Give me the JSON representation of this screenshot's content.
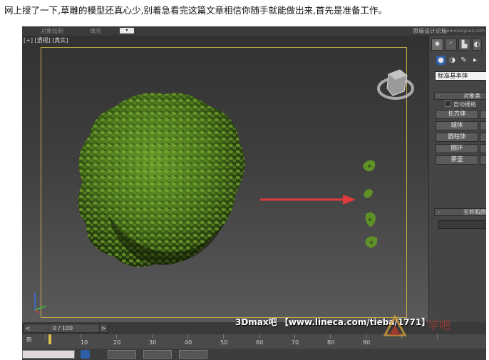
{
  "caption": "网上搜了一下,草雕的模型还真心少,别着急看完这篇文章相信你随手就能做出来,首先是准备工作。",
  "topbar": {
    "menu_left": "对象绘制",
    "menu_mid": "填充",
    "dropdown_value": "▾",
    "brand": "思缘设计论坛",
    "brand_url": "www.missyuan.com"
  },
  "viewport": {
    "label": "[+] [透视] [真实]",
    "frame_color": "#c9b045",
    "arrow_color": "#e23b3b",
    "foliage_color": "#4f7d1f"
  },
  "command_panel": {
    "tabs": [
      {
        "icon": "sun-icon",
        "glyph": "✸"
      },
      {
        "icon": "modify-arc-icon",
        "glyph": "◜"
      },
      {
        "icon": "hierarchy-icon",
        "glyph": "▙"
      },
      {
        "icon": "motion-icon",
        "glyph": "◐"
      }
    ],
    "subicons": [
      {
        "icon": "geometry-sphere-icon",
        "glyph": "●"
      },
      {
        "icon": "shapes-icon",
        "glyph": "◑"
      },
      {
        "icon": "lights-icon",
        "glyph": "✎"
      },
      {
        "icon": "camera-icon",
        "glyph": "▸"
      }
    ],
    "category_dropdown": "标准基本体",
    "object_type_title": "对象类",
    "autogrid_label": "自动栅格",
    "object_buttons": [
      "长方体",
      "球体",
      "圆柱体",
      "圆环",
      "茶壶"
    ],
    "name_color_title": "名称和颜"
  },
  "timeline": {
    "slider_label": "0 / 100",
    "prev_glyph": "<",
    "next_glyph": ">",
    "ticks": [
      "10",
      "20",
      "30",
      "40",
      "50",
      "60",
      "70",
      "80",
      "90"
    ]
  },
  "watermark": "3Dmax吧  【www.lineca.com/tieba/1771】",
  "logo_text": "学吧"
}
